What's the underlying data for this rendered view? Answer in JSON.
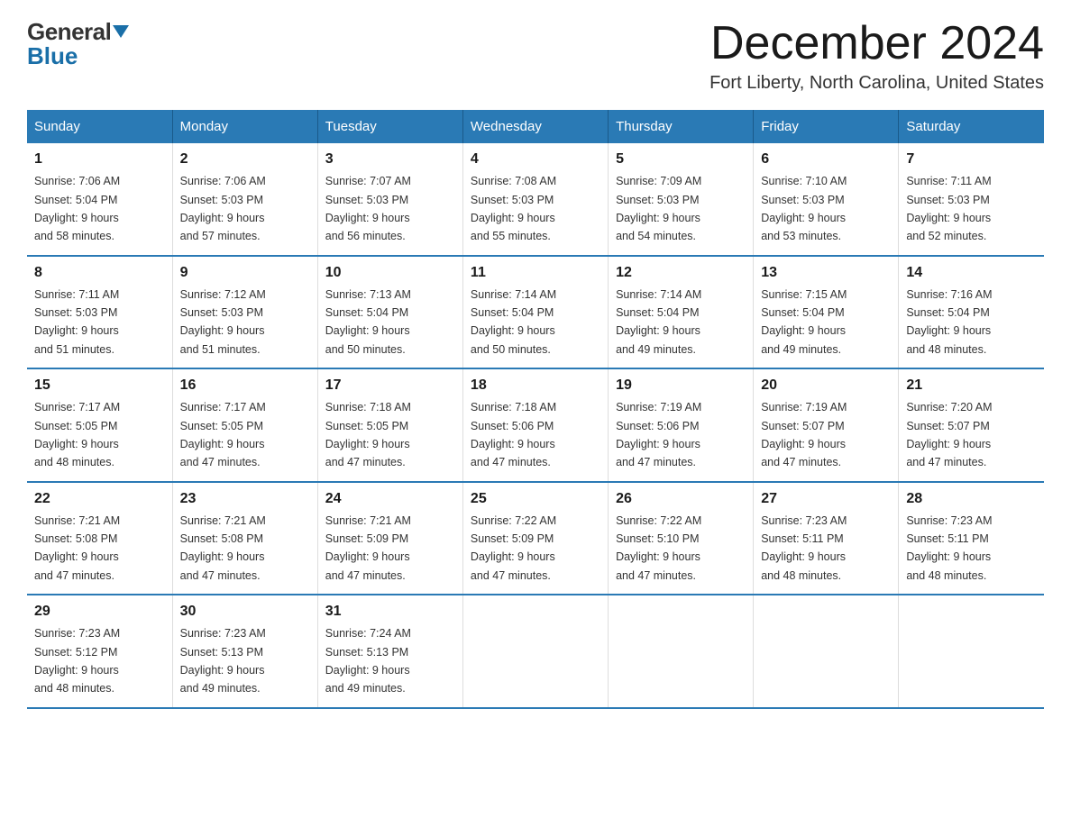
{
  "logo": {
    "general": "General",
    "blue": "Blue"
  },
  "title": "December 2024",
  "location": "Fort Liberty, North Carolina, United States",
  "days_of_week": [
    "Sunday",
    "Monday",
    "Tuesday",
    "Wednesday",
    "Thursday",
    "Friday",
    "Saturday"
  ],
  "weeks": [
    [
      {
        "day": "1",
        "sunrise": "7:06 AM",
        "sunset": "5:04 PM",
        "daylight": "9 hours and 58 minutes."
      },
      {
        "day": "2",
        "sunrise": "7:06 AM",
        "sunset": "5:03 PM",
        "daylight": "9 hours and 57 minutes."
      },
      {
        "day": "3",
        "sunrise": "7:07 AM",
        "sunset": "5:03 PM",
        "daylight": "9 hours and 56 minutes."
      },
      {
        "day": "4",
        "sunrise": "7:08 AM",
        "sunset": "5:03 PM",
        "daylight": "9 hours and 55 minutes."
      },
      {
        "day": "5",
        "sunrise": "7:09 AM",
        "sunset": "5:03 PM",
        "daylight": "9 hours and 54 minutes."
      },
      {
        "day": "6",
        "sunrise": "7:10 AM",
        "sunset": "5:03 PM",
        "daylight": "9 hours and 53 minutes."
      },
      {
        "day": "7",
        "sunrise": "7:11 AM",
        "sunset": "5:03 PM",
        "daylight": "9 hours and 52 minutes."
      }
    ],
    [
      {
        "day": "8",
        "sunrise": "7:11 AM",
        "sunset": "5:03 PM",
        "daylight": "9 hours and 51 minutes."
      },
      {
        "day": "9",
        "sunrise": "7:12 AM",
        "sunset": "5:03 PM",
        "daylight": "9 hours and 51 minutes."
      },
      {
        "day": "10",
        "sunrise": "7:13 AM",
        "sunset": "5:04 PM",
        "daylight": "9 hours and 50 minutes."
      },
      {
        "day": "11",
        "sunrise": "7:14 AM",
        "sunset": "5:04 PM",
        "daylight": "9 hours and 50 minutes."
      },
      {
        "day": "12",
        "sunrise": "7:14 AM",
        "sunset": "5:04 PM",
        "daylight": "9 hours and 49 minutes."
      },
      {
        "day": "13",
        "sunrise": "7:15 AM",
        "sunset": "5:04 PM",
        "daylight": "9 hours and 49 minutes."
      },
      {
        "day": "14",
        "sunrise": "7:16 AM",
        "sunset": "5:04 PM",
        "daylight": "9 hours and 48 minutes."
      }
    ],
    [
      {
        "day": "15",
        "sunrise": "7:17 AM",
        "sunset": "5:05 PM",
        "daylight": "9 hours and 48 minutes."
      },
      {
        "day": "16",
        "sunrise": "7:17 AM",
        "sunset": "5:05 PM",
        "daylight": "9 hours and 47 minutes."
      },
      {
        "day": "17",
        "sunrise": "7:18 AM",
        "sunset": "5:05 PM",
        "daylight": "9 hours and 47 minutes."
      },
      {
        "day": "18",
        "sunrise": "7:18 AM",
        "sunset": "5:06 PM",
        "daylight": "9 hours and 47 minutes."
      },
      {
        "day": "19",
        "sunrise": "7:19 AM",
        "sunset": "5:06 PM",
        "daylight": "9 hours and 47 minutes."
      },
      {
        "day": "20",
        "sunrise": "7:19 AM",
        "sunset": "5:07 PM",
        "daylight": "9 hours and 47 minutes."
      },
      {
        "day": "21",
        "sunrise": "7:20 AM",
        "sunset": "5:07 PM",
        "daylight": "9 hours and 47 minutes."
      }
    ],
    [
      {
        "day": "22",
        "sunrise": "7:21 AM",
        "sunset": "5:08 PM",
        "daylight": "9 hours and 47 minutes."
      },
      {
        "day": "23",
        "sunrise": "7:21 AM",
        "sunset": "5:08 PM",
        "daylight": "9 hours and 47 minutes."
      },
      {
        "day": "24",
        "sunrise": "7:21 AM",
        "sunset": "5:09 PM",
        "daylight": "9 hours and 47 minutes."
      },
      {
        "day": "25",
        "sunrise": "7:22 AM",
        "sunset": "5:09 PM",
        "daylight": "9 hours and 47 minutes."
      },
      {
        "day": "26",
        "sunrise": "7:22 AM",
        "sunset": "5:10 PM",
        "daylight": "9 hours and 47 minutes."
      },
      {
        "day": "27",
        "sunrise": "7:23 AM",
        "sunset": "5:11 PM",
        "daylight": "9 hours and 48 minutes."
      },
      {
        "day": "28",
        "sunrise": "7:23 AM",
        "sunset": "5:11 PM",
        "daylight": "9 hours and 48 minutes."
      }
    ],
    [
      {
        "day": "29",
        "sunrise": "7:23 AM",
        "sunset": "5:12 PM",
        "daylight": "9 hours and 48 minutes."
      },
      {
        "day": "30",
        "sunrise": "7:23 AM",
        "sunset": "5:13 PM",
        "daylight": "9 hours and 49 minutes."
      },
      {
        "day": "31",
        "sunrise": "7:24 AM",
        "sunset": "5:13 PM",
        "daylight": "9 hours and 49 minutes."
      },
      null,
      null,
      null,
      null
    ]
  ],
  "labels": {
    "sunrise": "Sunrise:",
    "sunset": "Sunset:",
    "daylight": "Daylight:"
  }
}
